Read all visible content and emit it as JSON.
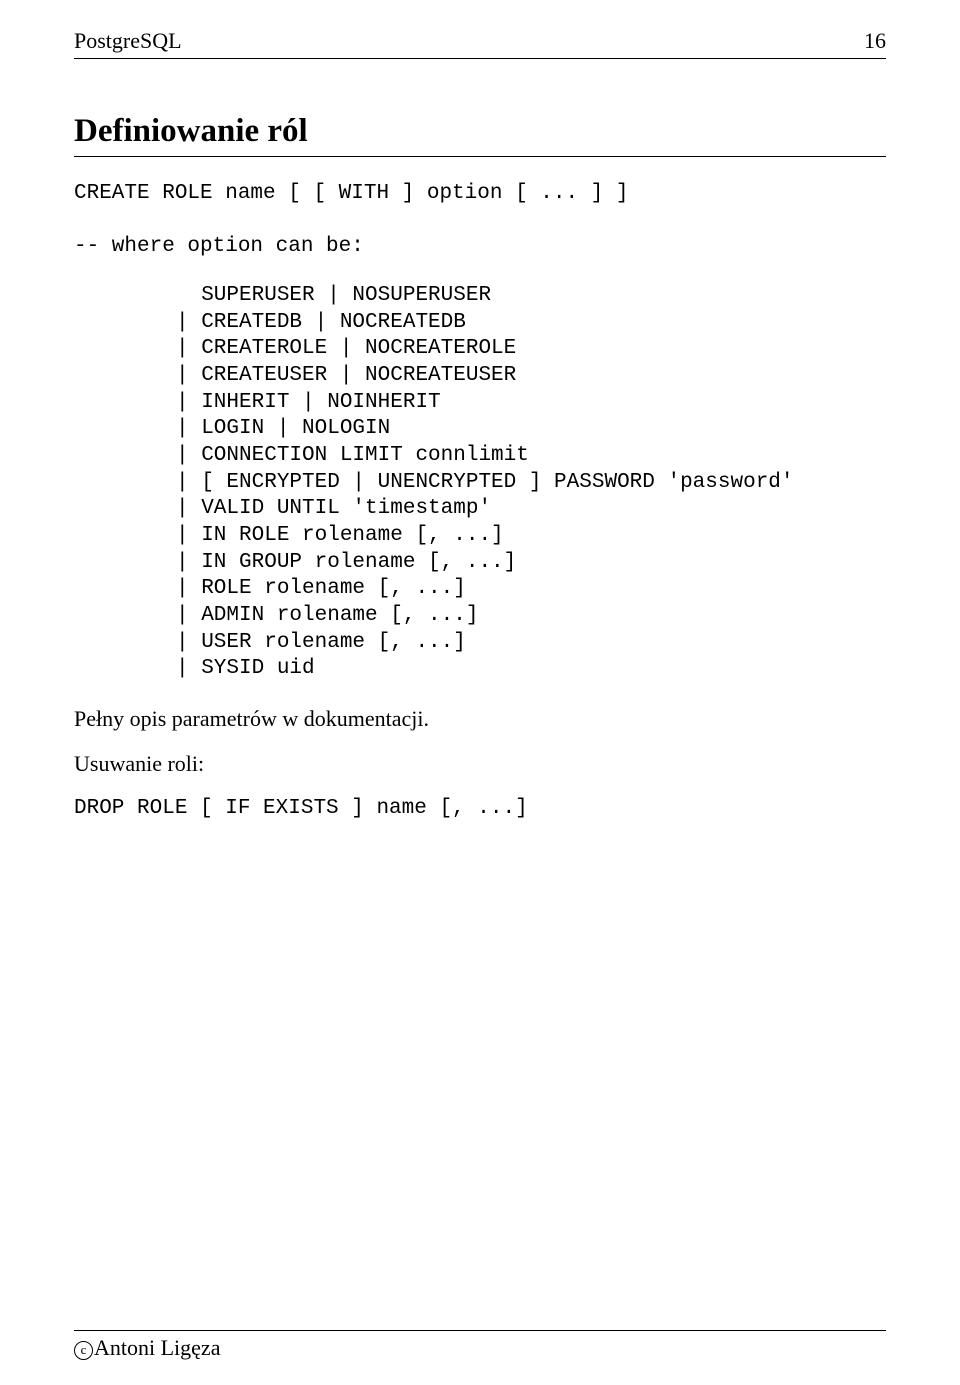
{
  "header": {
    "left": "PostgreSQL",
    "right": "16"
  },
  "section_title": "Definiowanie ról",
  "code1": "CREATE ROLE name [ [ WITH ] option [ ... ] ]\n\n-- where option can be:",
  "code2": "  SUPERUSER | NOSUPERUSER\n| CREATEDB | NOCREATEDB\n| CREATEROLE | NOCREATEROLE\n| CREATEUSER | NOCREATEUSER\n| INHERIT | NOINHERIT\n| LOGIN | NOLOGIN\n| CONNECTION LIMIT connlimit\n| [ ENCRYPTED | UNENCRYPTED ] PASSWORD 'password'\n| VALID UNTIL 'timestamp'\n| IN ROLE rolename [, ...]\n| IN GROUP rolename [, ...]\n| ROLE rolename [, ...]\n| ADMIN rolename [, ...]\n| USER rolename [, ...]\n| SYSID uid",
  "para1": "Pełny opis parametrów w dokumentacji.",
  "para2": "Usuwanie roli:",
  "code3": "DROP ROLE [ IF EXISTS ] name [, ...]",
  "footer": {
    "copyright_symbol": "c",
    "author": "Antoni Ligęza"
  }
}
